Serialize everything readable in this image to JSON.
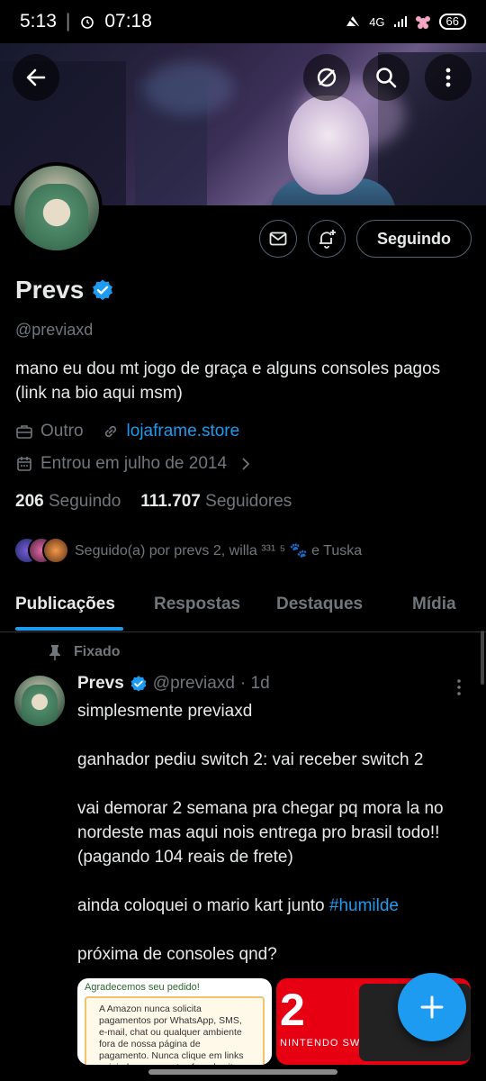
{
  "status_bar": {
    "time": "5:13",
    "alarm": "07:18",
    "network": "4G",
    "battery": "66"
  },
  "profile": {
    "display_name": "Prevs",
    "handle": "@previaxd",
    "bio": "mano eu dou mt jogo de graça e alguns consoles pagos (link na bio aqui msm)",
    "category": "Outro",
    "website": "lojaframe.store",
    "joined": "Entrou em julho de 2014",
    "following_count": "206",
    "following_label": "Seguindo",
    "followers_count": "111.707",
    "followers_label": "Seguidores",
    "followed_by": "Seguido(a) por prevs 2, willa ³³¹ ⁵ 🐾 e Tuska",
    "follow_button": "Seguindo"
  },
  "tabs": [
    "Publicações",
    "Respostas",
    "Destaques",
    "Mídia"
  ],
  "pinned_label": "Fixado",
  "post": {
    "name": "Prevs",
    "handle": "@previaxd",
    "time": "· 1d",
    "line1": "simplesmente previaxd",
    "line2": "ganhador pediu switch 2: vai receber switch 2",
    "line3": "vai demorar 2 semana pra chegar pq mora la no nordeste mas aqui nois entrega pro brasil todo!! (pagando 104 reais de frete)",
    "line4_text": "ainda coloquei o mario kart junto ",
    "line4_hashtag": "#humilde",
    "line5": "próxima de consoles qnd?",
    "media_left_header": "Agradecemos seu pedido!",
    "media_left_notice": "A Amazon nunca solicita pagamentos por WhatsApp, SMS, e-mail, chat ou qualquer ambiente fora de nossa página de pagamento. Nunca clique em links exigindo pagamentos fora do site da Amazon como condição de",
    "media_right_big": "2",
    "media_right_brand": "NINTENDO SWITCH"
  },
  "colors": {
    "accent": "#1d9bf0",
    "background": "#000000",
    "text_primary": "#e7e9ea",
    "text_secondary": "#71767b"
  },
  "icons": [
    "back-arrow-icon",
    "no-retweet-icon",
    "search-icon",
    "more-vertical-icon",
    "message-icon",
    "notification-add-icon",
    "verified-badge-icon",
    "briefcase-icon",
    "link-icon",
    "calendar-icon",
    "chevron-right-icon",
    "pin-icon",
    "compose-plus-icon"
  ]
}
